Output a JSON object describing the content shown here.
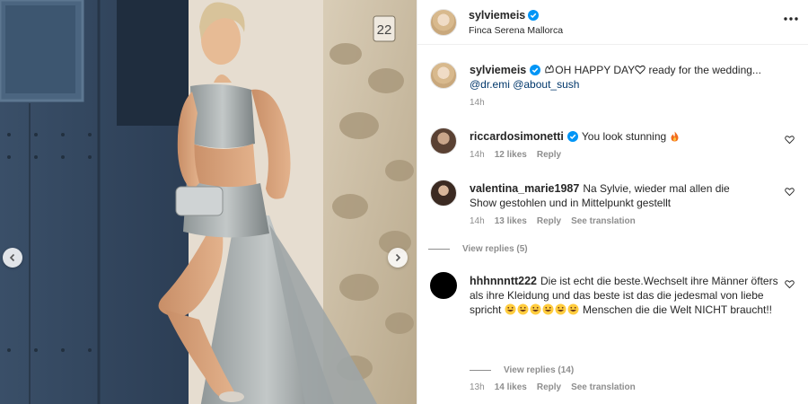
{
  "post": {
    "username": "sylviemeis",
    "location": "Finca Serena Mallorca",
    "house_number": "22"
  },
  "caption": {
    "username": "sylviemeis",
    "text_before": "OH HAPPY DAY",
    "text_after": " ready for the wedding...",
    "mention_1": "@dr.emi",
    "mention_2": "@about_sush",
    "time": "14h"
  },
  "comments": [
    {
      "username": "riccardosimonetti",
      "text": "You look stunning",
      "time": "14h",
      "likes": "12 likes",
      "reply": "Reply"
    },
    {
      "username": "valentina_marie1987",
      "text": "Na Sylvie, wieder mal allen die Show gestohlen und in Mittelpunkt gestellt",
      "time": "14h",
      "likes": "13 likes",
      "reply": "Reply",
      "translation": "See translation",
      "view_replies": "View replies (5)"
    },
    {
      "username": "hhhnnntt222",
      "text": "Die ist echt die beste.Wechselt ihre Männer öfters als ihre Kleidung und das beste ist das die jedesmal von liebe spricht",
      "text_after": " Menschen die die Welt NICHT braucht!!",
      "time": "13h",
      "likes": "14 likes",
      "reply": "Reply",
      "translation": "See translation",
      "view_replies": "View replies (14)"
    }
  ],
  "colors": {
    "verified": "#0095f6",
    "mention": "#00376b",
    "meta": "#8e8e8e",
    "text": "#262626"
  },
  "icons": {
    "verified": "verified-badge-icon",
    "more": "more-options-icon",
    "heart": "heart-icon",
    "prev": "chevron-left-icon",
    "next": "chevron-right-icon"
  }
}
